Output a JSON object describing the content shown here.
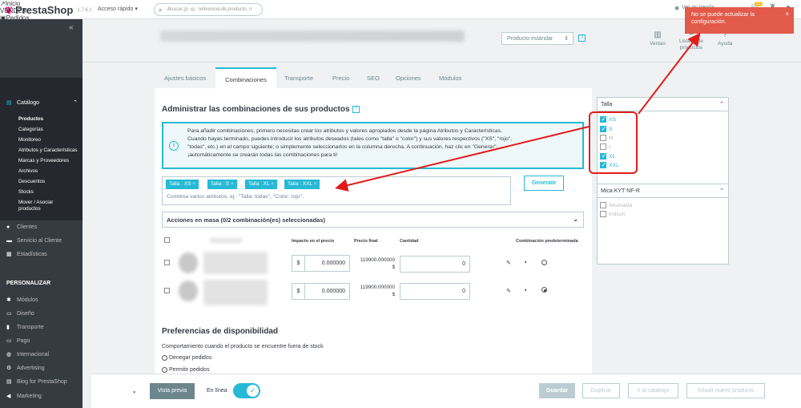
{
  "topbar": {
    "logo": "PrestaShop",
    "version": "1.7.6.1",
    "quick_access": "Acceso rápido",
    "search_placeholder": "Buscar (p. ej.: referencia de producto, n",
    "view_store": "Ver mi tienda",
    "notif_count": "10"
  },
  "toast": {
    "message": "No se puede actualizar la configuración.",
    "close": "×"
  },
  "sidebar": {
    "collapse": "«",
    "home": "Inicio",
    "sell_heading": "VENDER",
    "orders": "Pedidos",
    "catalog": "Catálogo",
    "catalog_sub": [
      "Productos",
      "Categorías",
      "Monitoreo",
      "Atributos y Características",
      "Marcas y Proveedores",
      "Archivos",
      "Descuentos",
      "Stocks",
      "Mover / Asociar productos"
    ],
    "clients": "Clientes",
    "customer_service": "Servicio al Cliente",
    "stats": "Estadísticas",
    "personalize_heading": "PERSONALIZAR",
    "modules": "Módulos",
    "design": "Diseño",
    "shipping": "Transporte",
    "payment": "Pago",
    "international": "Internacional",
    "advertising": "Advertising",
    "blog": "Blog for PrestaShop",
    "marketing": "Marketing"
  },
  "header": {
    "product_type": "Producto estándar",
    "sales": "Ventas",
    "product_list": "Listado de productos",
    "help": "Ayuda"
  },
  "tabs": [
    "Ajustes básicos",
    "Combinaciones",
    "Transporte",
    "Precio",
    "SEO",
    "Opciones",
    "Módulos"
  ],
  "combinations": {
    "title": "Administrar las combinaciones de sus productos",
    "info_lines": [
      "Para añadir combinaciones, primero necesitas crear los atributos y valores apropiados desde la página Atributos y Características.",
      "Cuando hayas terminado, puedes introducir los atributos deseados (tales como \"talla\" o \"color\") y sus valores respectivos (\"XS\", \"rojo\",",
      "\"todas\", etc.) en el campo siguiente; o simplemente seleccionarlos en la columna derecha. A continuación, haz clic en \"Generar\":",
      "¡automáticamente se crearán todas las combinaciones para ti!"
    ],
    "tags": [
      "Talla : XS",
      "Talla : S",
      "Talla : XL",
      "Talla : XXL"
    ],
    "tag_hint": "Combina varios atributos, ej.: \"Talla: todas\", \"Color: rojo\".",
    "generate": "Generate",
    "bulk": "Acciones en masa (0/2 combinación(es) seleccionadas)",
    "columns": [
      "Impacto en el precio",
      "Precio final",
      "Cantidad",
      "Combinación predeterminada"
    ],
    "rows": [
      {
        "currency": "$",
        "impact": "0.000000",
        "final": "119900.000000",
        "final_cur": "$",
        "qty": "0",
        "default": false
      },
      {
        "currency": "$",
        "impact": "0.000000",
        "final": "119900.000000",
        "final_cur": "$",
        "qty": "0",
        "default": true
      }
    ]
  },
  "availability": {
    "title": "Preferencias de disponibilidad",
    "subtitle": "Comportamiento cuando el producto se encuentre fuera de stock",
    "options": [
      "Denegar pedidos",
      "Permitir pedidos"
    ]
  },
  "attributes": {
    "talla_title": "Talla",
    "talla": [
      {
        "label": "XS",
        "checked": true
      },
      {
        "label": "S",
        "checked": true
      },
      {
        "label": "M",
        "checked": false
      },
      {
        "label": "L",
        "checked": false
      },
      {
        "label": "XL",
        "checked": true
      },
      {
        "label": "XXL",
        "checked": true
      }
    ],
    "mica_title": "Mica KYT NF-R",
    "mica": [
      {
        "label": "Ahumada",
        "checked": false
      },
      {
        "label": "Iridium",
        "checked": false
      }
    ]
  },
  "footer": {
    "preview": "Vista previa",
    "online": "En línea",
    "save": "Guardar",
    "duplicate": "Duplicar",
    "go_catalog": "Ir al catálogo",
    "add_new": "Añadir nuevo producto"
  },
  "colors": {
    "accent": "#25b9d7",
    "sidebar": "#363a41",
    "error": "#e25a4a",
    "annotation": "#e21b1b"
  }
}
